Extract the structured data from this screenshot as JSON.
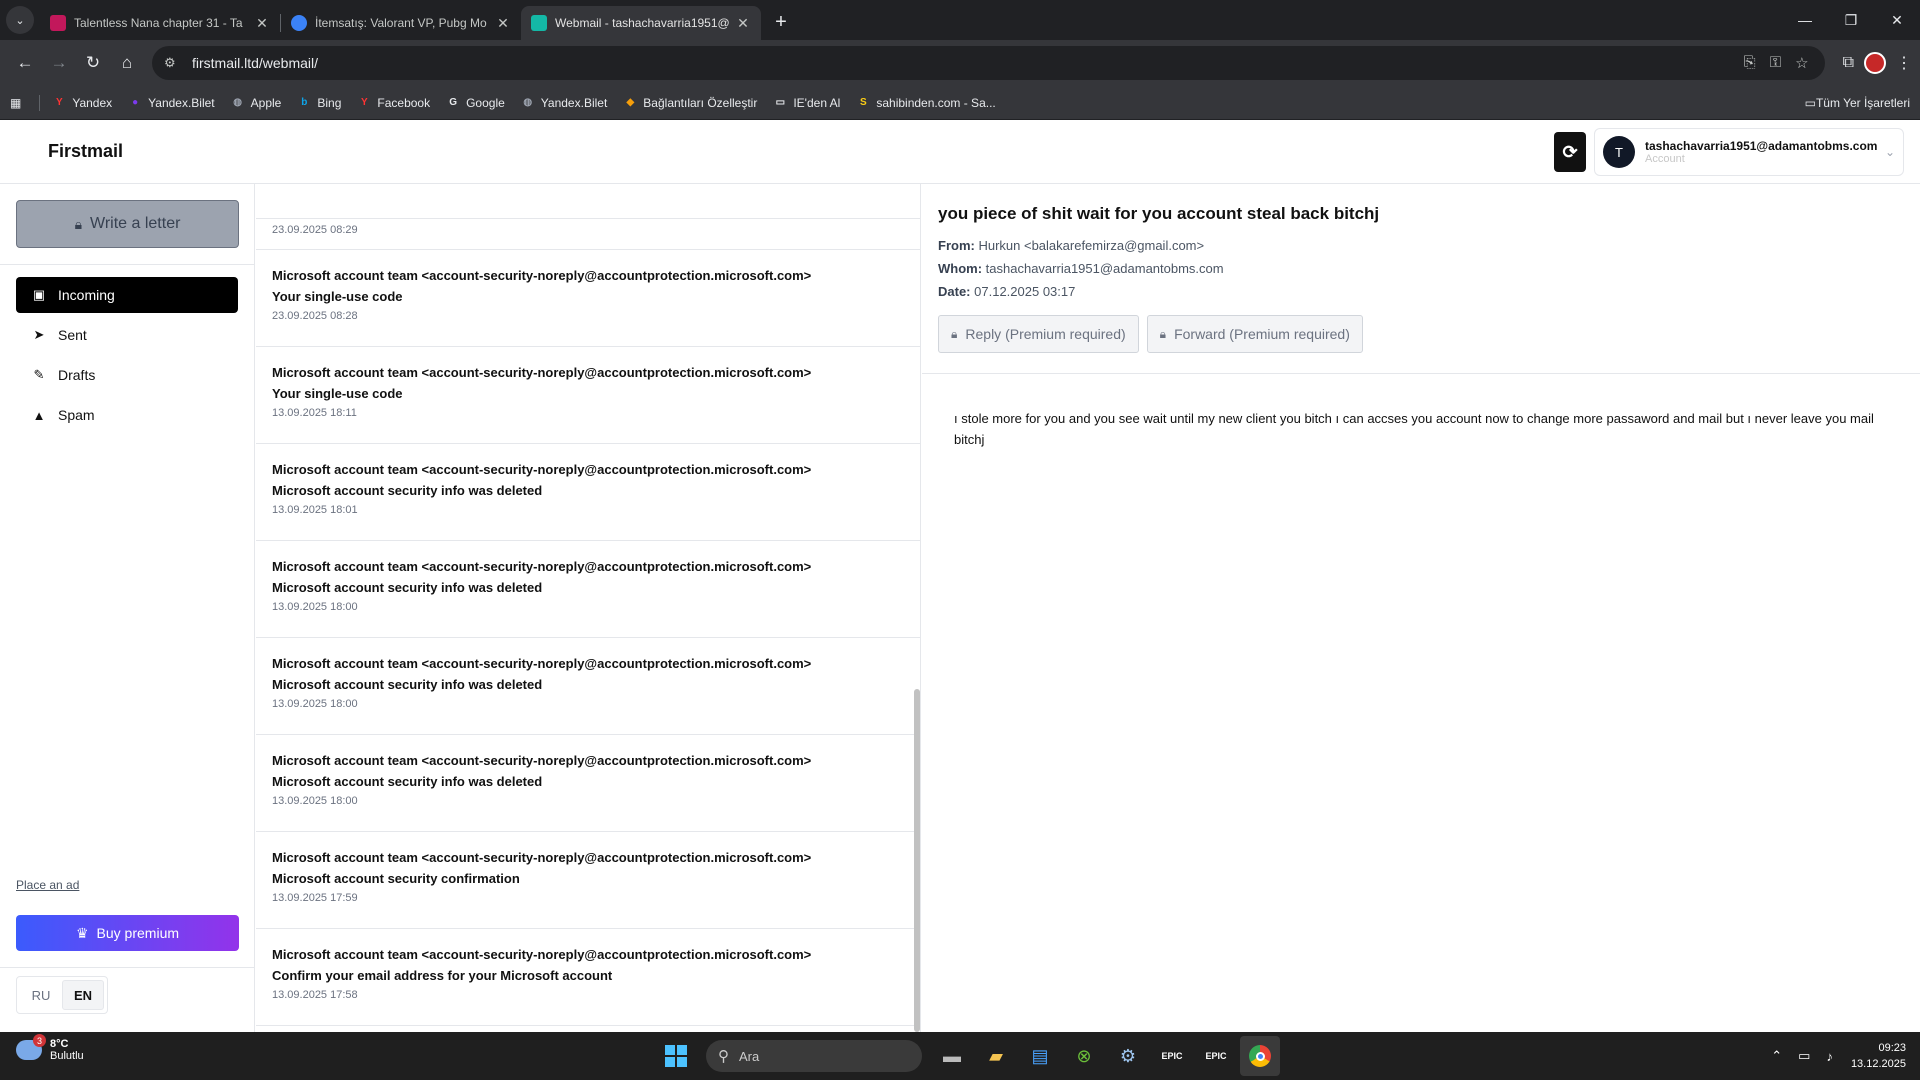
{
  "browser": {
    "tabs": [
      {
        "title": "Talentless Nana chapter 31 - Ta",
        "favicon_color": "#c2185b"
      },
      {
        "title": "İtemsatış: Valorant VP, Pubg Mo",
        "favicon_color": "#3b82f6"
      },
      {
        "title": "Webmail - tashachavarria1951@",
        "favicon_color": "#14b8a6"
      }
    ],
    "url": "firstmail.ltd/webmail/",
    "bookmarks": [
      {
        "label": "Yandex",
        "icon": "yandex-icon",
        "color": "#ff3333",
        "glyph": "Y"
      },
      {
        "label": "Yandex.Bilet",
        "icon": "yandex-bilet-icon",
        "color": "#7c3aed",
        "glyph": "●"
      },
      {
        "label": "Apple",
        "icon": "globe-icon",
        "color": "#9ca3af",
        "glyph": "◍"
      },
      {
        "label": "Bing",
        "icon": "bing-icon",
        "color": "#0ea5e9",
        "glyph": "b"
      },
      {
        "label": "Facebook",
        "icon": "facebook-icon",
        "color": "#ff3333",
        "glyph": "Y"
      },
      {
        "label": "Google",
        "icon": "google-icon",
        "color": "#e8eaed",
        "glyph": "G"
      },
      {
        "label": "Yandex.Bilet",
        "icon": "globe-icon",
        "color": "#9ca3af",
        "glyph": "◍"
      },
      {
        "label": "Bağlantıları Özelleştir",
        "icon": "windows-flag-icon",
        "color": "#f59e0b",
        "glyph": "◆"
      },
      {
        "label": "IE'den Al",
        "icon": "folder-icon",
        "color": "#e8eaed",
        "glyph": "▭"
      },
      {
        "label": "sahibinden.com - Sa...",
        "icon": "sahibinden-icon",
        "color": "#facc15",
        "glyph": "S"
      }
    ],
    "all_bookmarks_label": "Tüm Yer İşaretleri"
  },
  "app": {
    "logo": "Firstmail",
    "account_email": "tashachavarria1951@adamantobms.com",
    "account_sub": "Account",
    "avatar_letter": "T"
  },
  "sidebar": {
    "write_label": "Write a letter",
    "items": [
      {
        "label": "Incoming",
        "icon": "inbox-icon",
        "glyph": "▣",
        "active": true
      },
      {
        "label": "Sent",
        "icon": "send-icon",
        "glyph": "➤",
        "active": false
      },
      {
        "label": "Drafts",
        "icon": "edit-icon",
        "glyph": "✎",
        "active": false
      },
      {
        "label": "Spam",
        "icon": "warning-icon",
        "glyph": "▲",
        "active": false
      }
    ],
    "place_ad": "Place an ad",
    "buy_premium": "Buy premium",
    "languages": [
      "RU",
      "EN"
    ],
    "selected_language": "EN"
  },
  "maillist": {
    "partial_date": "23.09.2025 08:29",
    "items": [
      {
        "from": "Microsoft account team <account-security-noreply@accountprotection.microsoft.com>",
        "subject": "Your single-use code",
        "date": "23.09.2025 08:28"
      },
      {
        "from": "Microsoft account team <account-security-noreply@accountprotection.microsoft.com>",
        "subject": "Your single-use code",
        "date": "13.09.2025 18:11"
      },
      {
        "from": "Microsoft account team <account-security-noreply@accountprotection.microsoft.com>",
        "subject": "Microsoft account security info was deleted",
        "date": "13.09.2025 18:01"
      },
      {
        "from": "Microsoft account team <account-security-noreply@accountprotection.microsoft.com>",
        "subject": "Microsoft account security info was deleted",
        "date": "13.09.2025 18:00"
      },
      {
        "from": "Microsoft account team <account-security-noreply@accountprotection.microsoft.com>",
        "subject": "Microsoft account security info was deleted",
        "date": "13.09.2025 18:00"
      },
      {
        "from": "Microsoft account team <account-security-noreply@accountprotection.microsoft.com>",
        "subject": "Microsoft account security info was deleted",
        "date": "13.09.2025 18:00"
      },
      {
        "from": "Microsoft account team <account-security-noreply@accountprotection.microsoft.com>",
        "subject": "Microsoft account security confirmation",
        "date": "13.09.2025 17:59"
      },
      {
        "from": "Microsoft account team <account-security-noreply@accountprotection.microsoft.com>",
        "subject": "Confirm your email address for your Microsoft account",
        "date": "13.09.2025 17:58"
      }
    ]
  },
  "reader": {
    "subject": "you piece of shit wait for you account steal back bitchj",
    "from_label": "From:",
    "from_value": "Hurkun <balakarefemirza@gmail.com>",
    "whom_label": "Whom:",
    "whom_value": "tashachavarria1951@adamantobms.com",
    "date_label": "Date:",
    "date_value": "07.12.2025 03:17",
    "reply_label": "Reply (Premium required)",
    "forward_label": "Forward (Premium required)",
    "body": "ı stole more for you and you see wait until my new client you bitch ı can accses you account now to change more passaword and mail but ı never leave you  mail bitchj"
  },
  "taskbar": {
    "weather_badge": "3",
    "temperature": "8°C",
    "condition": "Bulutlu",
    "search_placeholder": "Ara",
    "time": "09:23",
    "date": "13.12.2025"
  }
}
